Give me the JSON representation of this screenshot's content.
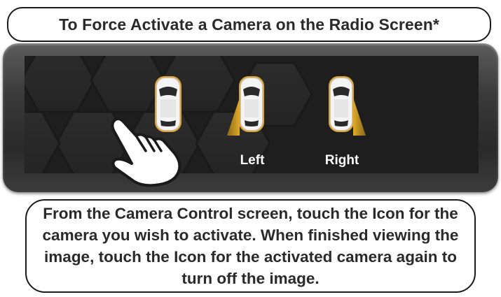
{
  "title": "To Force Activate a Camera on the Radio Screen*",
  "camera_screen": {
    "cameras": [
      {
        "label": "",
        "icon": "car-top-view-icon",
        "selected": true
      },
      {
        "label": "Left",
        "icon": "car-left-camera-icon",
        "selected": false
      },
      {
        "label": "Right",
        "icon": "car-right-camera-icon",
        "selected": false
      }
    ],
    "beam_color": "#d9a82a",
    "pointer_icon": "hand-pointer-icon"
  },
  "description": "From the Camera Control screen, touch the Icon for the camera you wish to activate. When finished viewing the image, touch the Icon for the activated camera again to turn off the image."
}
